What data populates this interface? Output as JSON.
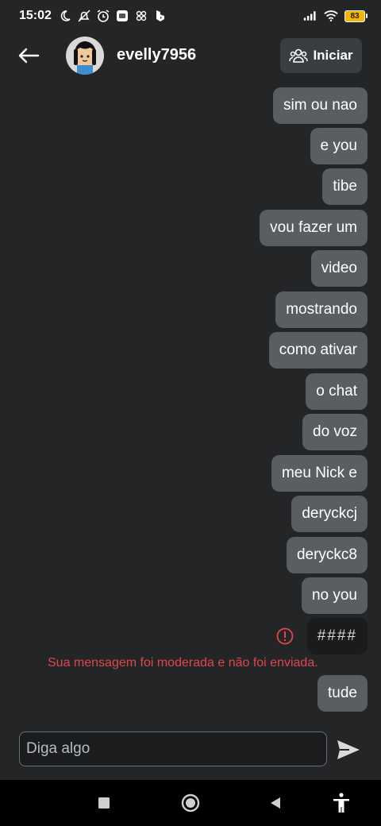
{
  "status_bar": {
    "time": "15:02",
    "battery_level": "83"
  },
  "header": {
    "username": "evelly7956",
    "start_label": "Iniciar"
  },
  "messages": [
    {
      "text": "sim ou nao",
      "moderated": false
    },
    {
      "text": "e you",
      "moderated": false
    },
    {
      "text": "tibe",
      "moderated": false
    },
    {
      "text": "vou fazer um",
      "moderated": false
    },
    {
      "text": "video",
      "moderated": false
    },
    {
      "text": "mostrando",
      "moderated": false
    },
    {
      "text": "como ativar",
      "moderated": false
    },
    {
      "text": "o chat",
      "moderated": false
    },
    {
      "text": "do voz",
      "moderated": false
    },
    {
      "text": "meu Nick e",
      "moderated": false
    },
    {
      "text": "deryckcj",
      "moderated": false
    },
    {
      "text": "deryckc8",
      "moderated": false
    },
    {
      "text": "no you",
      "moderated": false
    },
    {
      "text": "####",
      "moderated": true
    },
    {
      "text": "tude",
      "moderated": false
    }
  ],
  "moderation_notice": "Sua mensagem foi moderada e não foi enviada.",
  "composer": {
    "placeholder": "Diga algo"
  },
  "colors": {
    "background": "#232527",
    "bubble": "#5b5e61",
    "warning": "#e0464b"
  }
}
